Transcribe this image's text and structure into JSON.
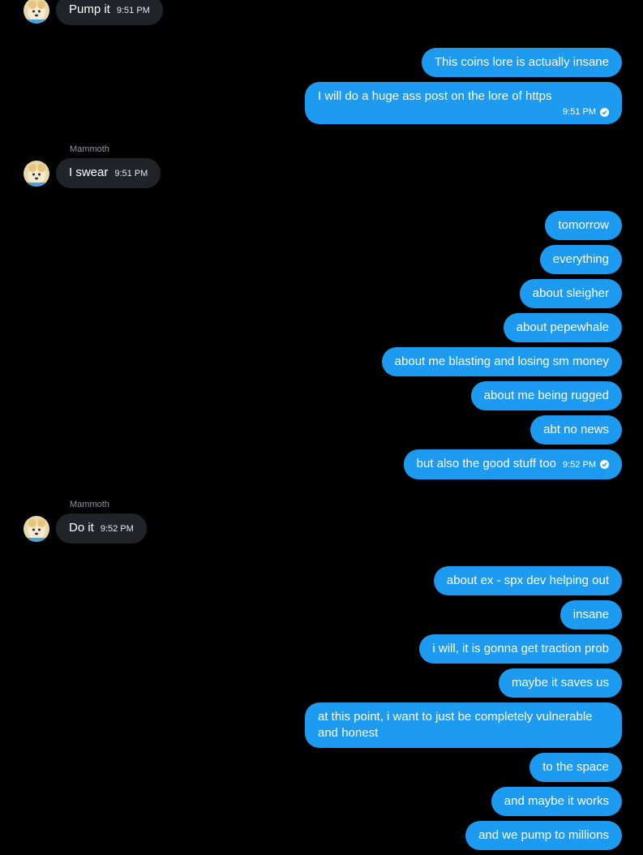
{
  "colors": {
    "background": "#000000",
    "outgoing_bubble": "#1d9bf0",
    "incoming_bubble": "#202327",
    "sender_name": "#8b98a5"
  },
  "messages": {
    "m1": {
      "text": "Pump it",
      "time": "9:51 PM",
      "avatar": "avatar-icon"
    },
    "m2": {
      "text": "This coins lore is actually insane"
    },
    "m3": {
      "text": "I will do a huge ass post on the lore of https",
      "time": "9:51 PM",
      "status": "checkmark-icon"
    },
    "m4_sender": "Mammoth",
    "m4": {
      "text": "I swear",
      "time": "9:51 PM"
    },
    "m5": {
      "text": "tomorrow"
    },
    "m6": {
      "text": "everything"
    },
    "m7": {
      "text": "about sleigher"
    },
    "m8": {
      "text": "about pepewhale"
    },
    "m9": {
      "text": "about me blasting and losing sm money"
    },
    "m10": {
      "text": "about me being rugged"
    },
    "m11": {
      "text": "abt no news"
    },
    "m12": {
      "text": "but also the good stuff too",
      "time": "9:52 PM"
    },
    "m13_sender": "Mammoth",
    "m13": {
      "text": "Do it",
      "time": "9:52 PM"
    },
    "m14": {
      "text": "about ex - spx dev helping out"
    },
    "m15": {
      "text": "insane"
    },
    "m16": {
      "text": "i will, it is gonna get traction prob"
    },
    "m17": {
      "text": "maybe it saves us"
    },
    "m18": {
      "text": "at this point, i want to just be completely vulnerable and honest"
    },
    "m19": {
      "text": "to the space"
    },
    "m20": {
      "text": "and maybe it works"
    },
    "m21": {
      "text": "and we pump to millions"
    }
  }
}
